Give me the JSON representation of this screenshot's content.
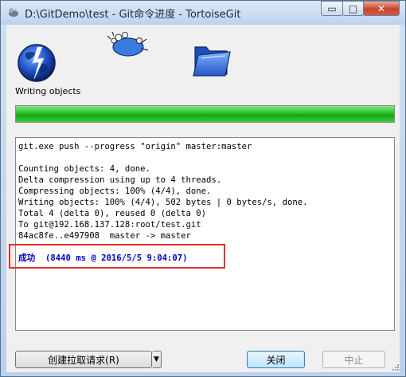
{
  "window": {
    "title": "D:\\GitDemo\\test - Git命令进度 - TortoiseGit",
    "controls": {
      "minimize": "▭",
      "maximize": "□",
      "close": "✕"
    }
  },
  "status": {
    "text": "Writing objects",
    "progress_percent": 100
  },
  "log": {
    "lines": [
      "git.exe push --progress \"origin\" master:master",
      "",
      "Counting objects: 4, done.",
      "Delta compression using up to 4 threads.",
      "Compressing objects: 100% (4/4), done.",
      "Writing objects: 100% (4/4), 502 bytes | 0 bytes/s, done.",
      "Total 4 (delta 0), reused 0 (delta 0)",
      "To git@192.168.137.128:root/test.git",
      "84ac8fe..e497908  master -> master",
      ""
    ],
    "result": "成功  (8440 ms @ 2016/5/5 9:04:07)"
  },
  "buttons": {
    "pull_request": "创建拉取请求(R)",
    "pull_request_arrow": "▼",
    "close": "关闭",
    "stop": "中止"
  },
  "colors": {
    "progress": "#22b422",
    "highlight": "#e0322d",
    "success_text": "#0000c0"
  }
}
